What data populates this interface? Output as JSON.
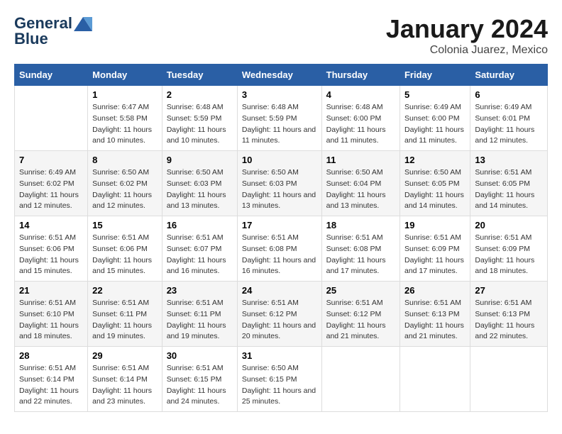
{
  "logo": {
    "line1": "General",
    "line2": "Blue"
  },
  "title": "January 2024",
  "subtitle": "Colonia Juarez, Mexico",
  "days_header": [
    "Sunday",
    "Monday",
    "Tuesday",
    "Wednesday",
    "Thursday",
    "Friday",
    "Saturday"
  ],
  "weeks": [
    [
      {
        "day": "",
        "sunrise": "",
        "sunset": "",
        "daylight": ""
      },
      {
        "day": "1",
        "sunrise": "Sunrise: 6:47 AM",
        "sunset": "Sunset: 5:58 PM",
        "daylight": "Daylight: 11 hours and 10 minutes."
      },
      {
        "day": "2",
        "sunrise": "Sunrise: 6:48 AM",
        "sunset": "Sunset: 5:59 PM",
        "daylight": "Daylight: 11 hours and 10 minutes."
      },
      {
        "day": "3",
        "sunrise": "Sunrise: 6:48 AM",
        "sunset": "Sunset: 5:59 PM",
        "daylight": "Daylight: 11 hours and 11 minutes."
      },
      {
        "day": "4",
        "sunrise": "Sunrise: 6:48 AM",
        "sunset": "Sunset: 6:00 PM",
        "daylight": "Daylight: 11 hours and 11 minutes."
      },
      {
        "day": "5",
        "sunrise": "Sunrise: 6:49 AM",
        "sunset": "Sunset: 6:00 PM",
        "daylight": "Daylight: 11 hours and 11 minutes."
      },
      {
        "day": "6",
        "sunrise": "Sunrise: 6:49 AM",
        "sunset": "Sunset: 6:01 PM",
        "daylight": "Daylight: 11 hours and 12 minutes."
      }
    ],
    [
      {
        "day": "7",
        "sunrise": "Sunrise: 6:49 AM",
        "sunset": "Sunset: 6:02 PM",
        "daylight": "Daylight: 11 hours and 12 minutes."
      },
      {
        "day": "8",
        "sunrise": "Sunrise: 6:50 AM",
        "sunset": "Sunset: 6:02 PM",
        "daylight": "Daylight: 11 hours and 12 minutes."
      },
      {
        "day": "9",
        "sunrise": "Sunrise: 6:50 AM",
        "sunset": "Sunset: 6:03 PM",
        "daylight": "Daylight: 11 hours and 13 minutes."
      },
      {
        "day": "10",
        "sunrise": "Sunrise: 6:50 AM",
        "sunset": "Sunset: 6:03 PM",
        "daylight": "Daylight: 11 hours and 13 minutes."
      },
      {
        "day": "11",
        "sunrise": "Sunrise: 6:50 AM",
        "sunset": "Sunset: 6:04 PM",
        "daylight": "Daylight: 11 hours and 13 minutes."
      },
      {
        "day": "12",
        "sunrise": "Sunrise: 6:50 AM",
        "sunset": "Sunset: 6:05 PM",
        "daylight": "Daylight: 11 hours and 14 minutes."
      },
      {
        "day": "13",
        "sunrise": "Sunrise: 6:51 AM",
        "sunset": "Sunset: 6:05 PM",
        "daylight": "Daylight: 11 hours and 14 minutes."
      }
    ],
    [
      {
        "day": "14",
        "sunrise": "Sunrise: 6:51 AM",
        "sunset": "Sunset: 6:06 PM",
        "daylight": "Daylight: 11 hours and 15 minutes."
      },
      {
        "day": "15",
        "sunrise": "Sunrise: 6:51 AM",
        "sunset": "Sunset: 6:06 PM",
        "daylight": "Daylight: 11 hours and 15 minutes."
      },
      {
        "day": "16",
        "sunrise": "Sunrise: 6:51 AM",
        "sunset": "Sunset: 6:07 PM",
        "daylight": "Daylight: 11 hours and 16 minutes."
      },
      {
        "day": "17",
        "sunrise": "Sunrise: 6:51 AM",
        "sunset": "Sunset: 6:08 PM",
        "daylight": "Daylight: 11 hours and 16 minutes."
      },
      {
        "day": "18",
        "sunrise": "Sunrise: 6:51 AM",
        "sunset": "Sunset: 6:08 PM",
        "daylight": "Daylight: 11 hours and 17 minutes."
      },
      {
        "day": "19",
        "sunrise": "Sunrise: 6:51 AM",
        "sunset": "Sunset: 6:09 PM",
        "daylight": "Daylight: 11 hours and 17 minutes."
      },
      {
        "day": "20",
        "sunrise": "Sunrise: 6:51 AM",
        "sunset": "Sunset: 6:09 PM",
        "daylight": "Daylight: 11 hours and 18 minutes."
      }
    ],
    [
      {
        "day": "21",
        "sunrise": "Sunrise: 6:51 AM",
        "sunset": "Sunset: 6:10 PM",
        "daylight": "Daylight: 11 hours and 18 minutes."
      },
      {
        "day": "22",
        "sunrise": "Sunrise: 6:51 AM",
        "sunset": "Sunset: 6:11 PM",
        "daylight": "Daylight: 11 hours and 19 minutes."
      },
      {
        "day": "23",
        "sunrise": "Sunrise: 6:51 AM",
        "sunset": "Sunset: 6:11 PM",
        "daylight": "Daylight: 11 hours and 19 minutes."
      },
      {
        "day": "24",
        "sunrise": "Sunrise: 6:51 AM",
        "sunset": "Sunset: 6:12 PM",
        "daylight": "Daylight: 11 hours and 20 minutes."
      },
      {
        "day": "25",
        "sunrise": "Sunrise: 6:51 AM",
        "sunset": "Sunset: 6:12 PM",
        "daylight": "Daylight: 11 hours and 21 minutes."
      },
      {
        "day": "26",
        "sunrise": "Sunrise: 6:51 AM",
        "sunset": "Sunset: 6:13 PM",
        "daylight": "Daylight: 11 hours and 21 minutes."
      },
      {
        "day": "27",
        "sunrise": "Sunrise: 6:51 AM",
        "sunset": "Sunset: 6:13 PM",
        "daylight": "Daylight: 11 hours and 22 minutes."
      }
    ],
    [
      {
        "day": "28",
        "sunrise": "Sunrise: 6:51 AM",
        "sunset": "Sunset: 6:14 PM",
        "daylight": "Daylight: 11 hours and 22 minutes."
      },
      {
        "day": "29",
        "sunrise": "Sunrise: 6:51 AM",
        "sunset": "Sunset: 6:14 PM",
        "daylight": "Daylight: 11 hours and 23 minutes."
      },
      {
        "day": "30",
        "sunrise": "Sunrise: 6:51 AM",
        "sunset": "Sunset: 6:15 PM",
        "daylight": "Daylight: 11 hours and 24 minutes."
      },
      {
        "day": "31",
        "sunrise": "Sunrise: 6:50 AM",
        "sunset": "Sunset: 6:15 PM",
        "daylight": "Daylight: 11 hours and 25 minutes."
      },
      {
        "day": "",
        "sunrise": "",
        "sunset": "",
        "daylight": ""
      },
      {
        "day": "",
        "sunrise": "",
        "sunset": "",
        "daylight": ""
      },
      {
        "day": "",
        "sunrise": "",
        "sunset": "",
        "daylight": ""
      }
    ]
  ]
}
